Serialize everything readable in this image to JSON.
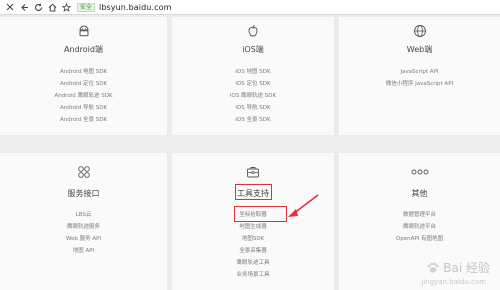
{
  "browser": {
    "secure_label": "安全",
    "url": "lbsyun.baidu.com"
  },
  "panels": [
    {
      "id": "android",
      "title": "Android端",
      "icon": "android-icon",
      "links": [
        "Android 地图 SDK",
        "Android 定位 SDK",
        "Android 鹰眼轨迹 SDK",
        "Android 导航 SDK",
        "Android 全景 SDK"
      ]
    },
    {
      "id": "ios",
      "title": "iOS端",
      "icon": "apple-icon",
      "links": [
        "iOS 地图 SDK",
        "iOS 定位 SDK",
        "iOS 鹰眼轨迹 SDK",
        "iOS 导航 SDK",
        "iOS 全景 SDK"
      ]
    },
    {
      "id": "web",
      "title": "Web端",
      "icon": "globe-icon",
      "links": [
        "JavaScript API",
        "微信小程序 JavaScript API"
      ]
    },
    {
      "id": "service",
      "title": "服务接口",
      "icon": "grid-icon",
      "links": [
        "LBS云",
        "鹰眼轨迹服务",
        "Web 服务 API",
        "地图 API"
      ]
    },
    {
      "id": "tools",
      "title": "工具支持",
      "icon": "toolbox-icon",
      "links": [
        "坐标拾取器",
        "地图生成器",
        "地图SDK",
        "全景采集器",
        "鹰眼轨迹工具",
        "业务场景工具"
      ]
    },
    {
      "id": "other",
      "title": "其他",
      "icon": "more-icon",
      "links": [
        "数据管理平台",
        "鹰眼轨迹平台",
        "OpenAPI 有图地图"
      ]
    }
  ],
  "watermark": {
    "text": "Bai 经验",
    "sub": "jingyan.baidu.com"
  },
  "colors": {
    "highlight": "#e0303a",
    "panel_bg": "#fafafa",
    "page_bg": "#ececec"
  }
}
